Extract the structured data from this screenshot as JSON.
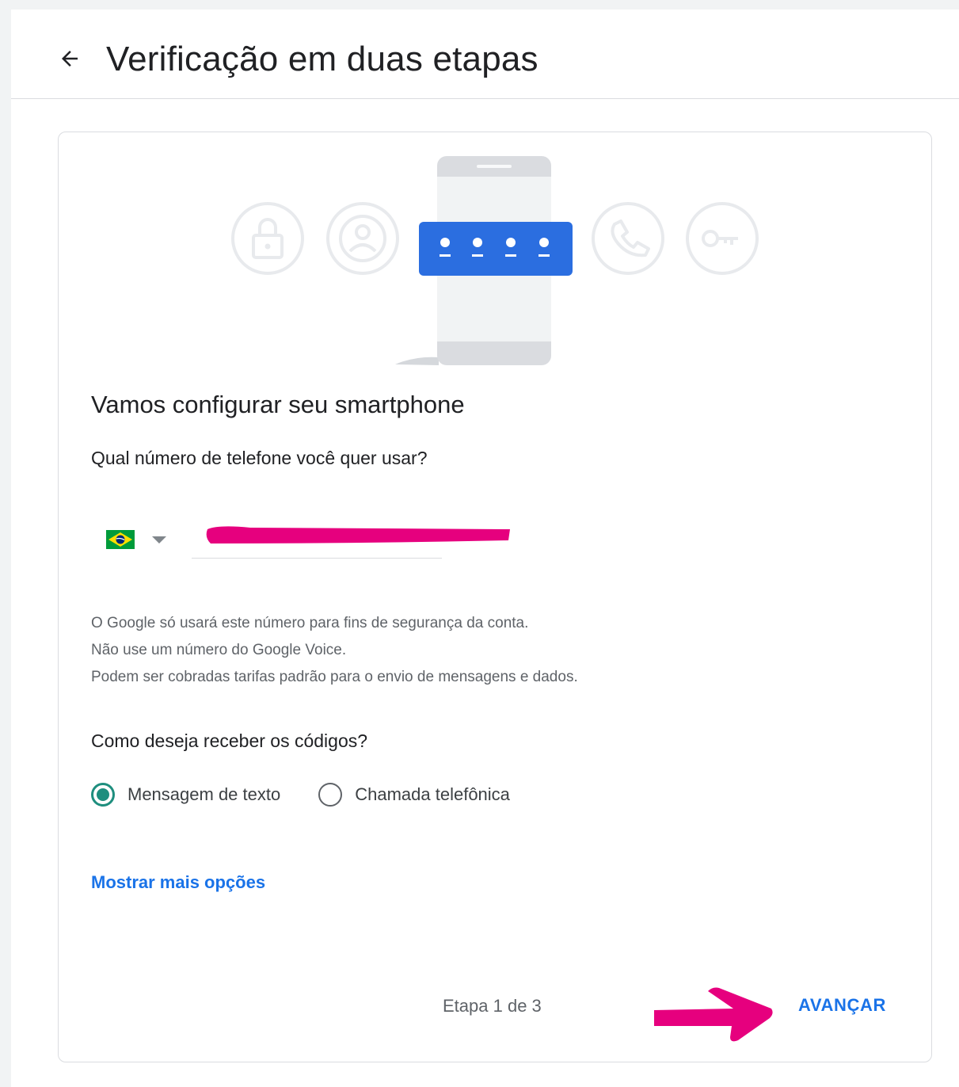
{
  "header": {
    "title": "Verificação em duas etapas",
    "back_icon": "arrow-back-icon"
  },
  "card": {
    "heading": "Vamos configurar seu smartphone",
    "phone_question": "Qual número de telefone você quer usar?",
    "country": {
      "flag_icon": "brazil-flag-icon",
      "dropdown_icon": "caret-down-icon"
    },
    "phone_input": {
      "value": "",
      "redacted": true
    },
    "info_lines": [
      "O Google só usará este número para fins de segurança da conta.",
      "Não use um número do Google Voice.",
      "Podem ser cobradas tarifas padrão para o envio de mensagens e dados."
    ],
    "codes_question": "Como deseja receber os códigos?",
    "delivery_options": [
      {
        "label": "Mensagem de texto",
        "selected": true
      },
      {
        "label": "Chamada telefônica",
        "selected": false
      }
    ],
    "more_options_link": "Mostrar mais opções",
    "step_text": "Etapa 1 de 3",
    "next_button": "AVANÇAR"
  },
  "hero_icons": [
    "lock-icon",
    "account-icon",
    "password-dots-icon",
    "phone-icon",
    "key-icon"
  ],
  "colors": {
    "accent": "#1a73e8",
    "radio_selected": "#1e8e7e",
    "annotation": "#e6007e",
    "border": "#dadce0"
  }
}
